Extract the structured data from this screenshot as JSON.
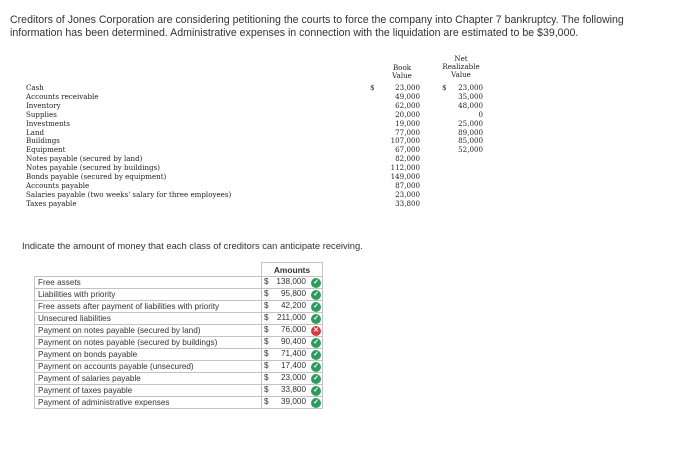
{
  "intro": {
    "line1": "Creditors of Jones Corporation are considering petitioning the courts to force the company into Chapter 7 bankruptcy. The following",
    "line2": "information has been determined. Administrative expenses in connection with the liquidation are estimated to be $39,000."
  },
  "financials": {
    "headers": {
      "book_line1": "Book",
      "book_line2": "Value",
      "nrv_line1": "Net",
      "nrv_line2": "Realizable",
      "nrv_line3": "Value"
    },
    "dollar_sign": "$",
    "rows": [
      {
        "label": "Cash",
        "book": "23,000",
        "nrv": "23,000"
      },
      {
        "label": "Accounts receivable",
        "book": "49,000",
        "nrv": "35,000"
      },
      {
        "label": "Inventory",
        "book": "62,000",
        "nrv": "48,000"
      },
      {
        "label": "Supplies",
        "book": "20,000",
        "nrv": "0"
      },
      {
        "label": "Investments",
        "book": "19,000",
        "nrv": "25,000"
      },
      {
        "label": "Land",
        "book": "77,000",
        "nrv": "89,000"
      },
      {
        "label": "Buildings",
        "book": "107,000",
        "nrv": "85,000"
      },
      {
        "label": "Equipment",
        "book": "67,000",
        "nrv": "52,000"
      },
      {
        "label": "Notes payable (secured by land)",
        "book": "82,000",
        "nrv": ""
      },
      {
        "label": "Notes payable (secured by buildings)",
        "book": "112,000",
        "nrv": ""
      },
      {
        "label": "Bonds payable (secured by equipment)",
        "book": "149,000",
        "nrv": ""
      },
      {
        "label": "Accounts payable",
        "book": "87,000",
        "nrv": ""
      },
      {
        "label": "Salaries payable (two weeks' salary for three employees)",
        "book": "23,000",
        "nrv": ""
      },
      {
        "label": "Taxes payable",
        "book": "33,800",
        "nrv": ""
      }
    ]
  },
  "question": "Indicate the amount of money that each class of creditors can anticipate receiving.",
  "answer": {
    "header": "Amounts",
    "currency": "$",
    "rows": [
      {
        "label": "Free assets",
        "value": "138,000",
        "status": "correct"
      },
      {
        "label": "Liabilities with priority",
        "value": "95,800",
        "status": "correct"
      },
      {
        "label": "Free assets after payment of liabilities with priority",
        "value": "42,200",
        "status": "correct"
      },
      {
        "label": "Unsecured liabilities",
        "value": "211,000",
        "status": "correct"
      },
      {
        "label": "Payment on notes payable (secured by land)",
        "value": "76,000",
        "status": "incorrect"
      },
      {
        "label": "Payment on notes payable (secured by buildings)",
        "value": "90,400",
        "status": "correct"
      },
      {
        "label": "Payment on bonds payable",
        "value": "71,400",
        "status": "correct"
      },
      {
        "label": "Payment on accounts payable (unsecured)",
        "value": "17,400",
        "status": "correct"
      },
      {
        "label": "Payment of salaries payable",
        "value": "23,000",
        "status": "correct"
      },
      {
        "label": "Payment of taxes payable",
        "value": "33,800",
        "status": "correct"
      },
      {
        "label": "Payment of administrative expenses",
        "value": "39,000",
        "status": "correct"
      }
    ]
  }
}
